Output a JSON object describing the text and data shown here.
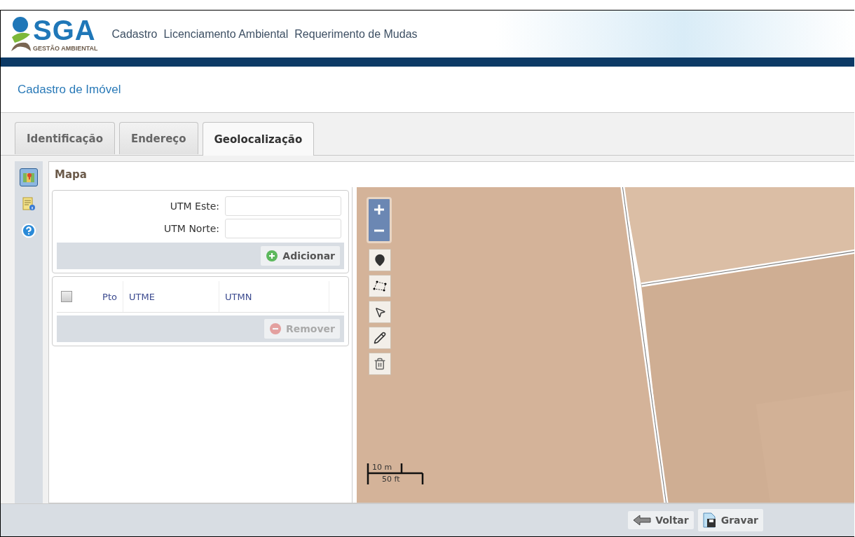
{
  "header": {
    "logo": {
      "wordmark": "SGA",
      "tagline": "GESTÃO AMBIENTAL"
    },
    "menu": [
      {
        "label": "Cadastro"
      },
      {
        "label": "Licenciamento Ambiental"
      },
      {
        "label": "Requerimento de Mudas"
      }
    ]
  },
  "page_title": "Cadastro de Imóvel",
  "tabs": [
    {
      "label": "Identificação",
      "selected": false
    },
    {
      "label": "Endereço",
      "selected": false
    },
    {
      "label": "Geolocalização",
      "selected": true
    }
  ],
  "side_tools": [
    {
      "kind": "map",
      "selected": true
    },
    {
      "kind": "info",
      "selected": false
    },
    {
      "kind": "help",
      "selected": false
    }
  ],
  "panel": {
    "title": "Mapa",
    "form": {
      "fields": [
        {
          "label": "UTM Este:"
        },
        {
          "label": "UTM Norte:"
        }
      ],
      "add_button": {
        "label": "Adicionar"
      }
    },
    "points_table": {
      "select_all_checked": false,
      "columns": [
        "Pto",
        "UTME",
        "UTMN"
      ],
      "remove_button": {
        "label": "Remover",
        "disabled": true
      }
    },
    "map": {
      "kind": "picture",
      "tools": [
        {
          "kind": "marker"
        },
        {
          "kind": "polygon"
        },
        {
          "kind": "pointer"
        },
        {
          "kind": "pencil"
        },
        {
          "kind": "trash"
        }
      ],
      "scale": {
        "metric": "10 m",
        "imperial": "50 ft"
      }
    }
  },
  "footer": {
    "buttons": [
      {
        "kind": "back",
        "label": "Voltar"
      },
      {
        "kind": "save",
        "label": "Gravar"
      }
    ]
  }
}
